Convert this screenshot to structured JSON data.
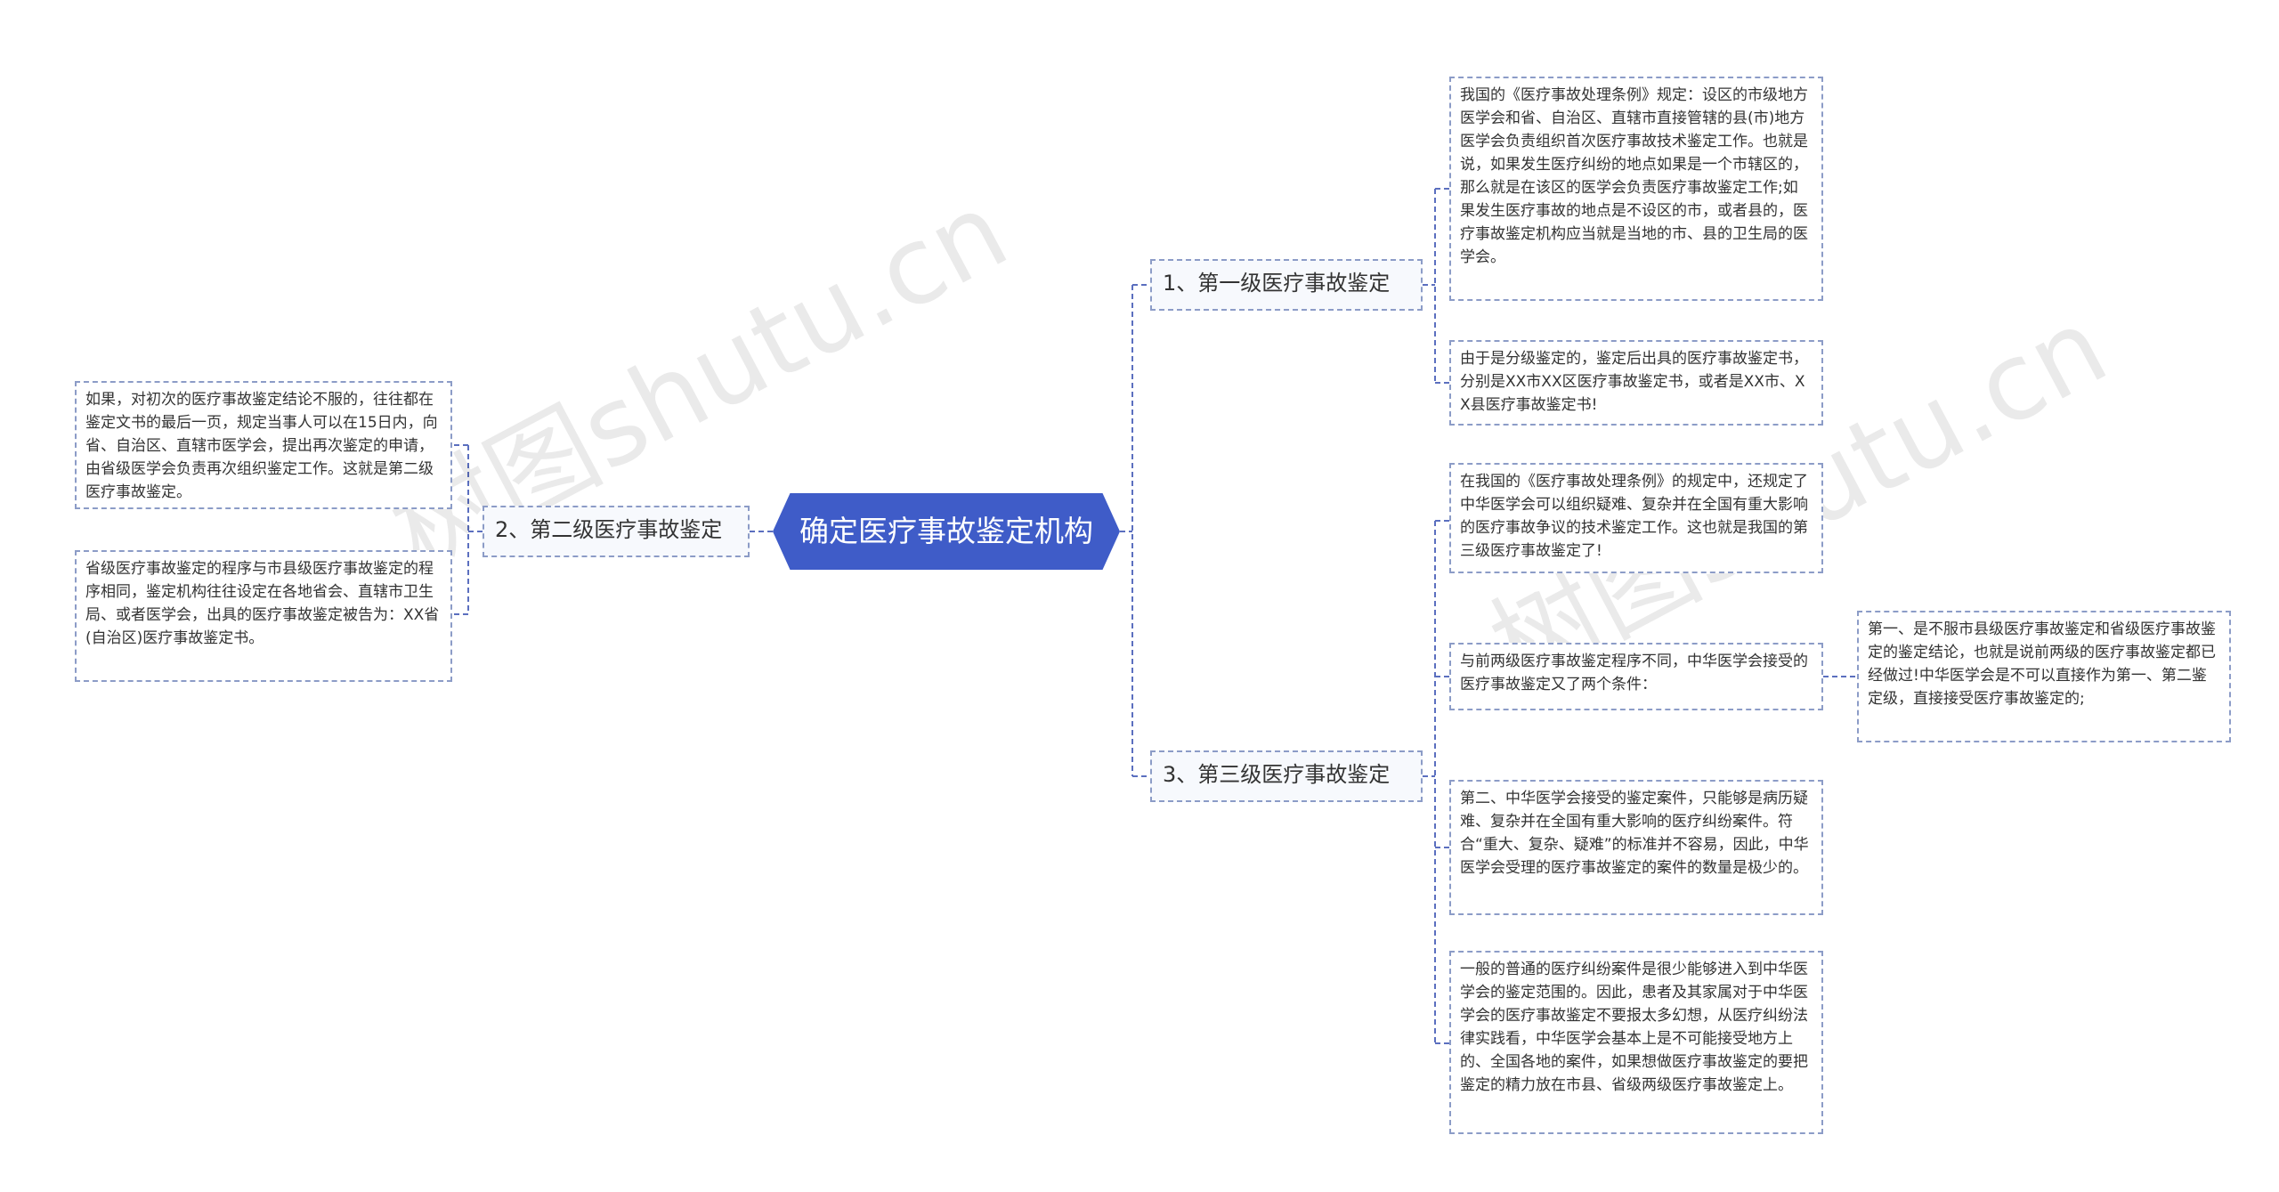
{
  "root": {
    "label": "确定医疗事故鉴定机构"
  },
  "branches": {
    "first": {
      "label": "1、第一级医疗事故鉴定",
      "details": [
        "我国的《医疗事故处理条例》规定：设区的市级地方医学会和省、自治区、直辖市直接管辖的县(市)地方医学会负责组织首次医疗事故技术鉴定工作。也就是说，如果发生医疗纠纷的地点如果是一个市辖区的，那么就是在该区的医学会负责医疗事故鉴定工作;如果发生医疗事故的地点是不设区的市，或者县的，医疗事故鉴定机构应当就是当地的市、县的卫生局的医学会。",
        "由于是分级鉴定的，鉴定后出具的医疗事故鉴定书，分别是XX市XX区医疗事故鉴定书，或者是XX市、XX县医疗事故鉴定书!"
      ]
    },
    "second": {
      "label": "2、第二级医疗事故鉴定",
      "details": [
        "如果，对初次的医疗事故鉴定结论不服的，往往都在鉴定文书的最后一页，规定当事人可以在15日内，向省、自治区、直辖市医学会，提出再次鉴定的申请，由省级医学会负责再次组织鉴定工作。这就是第二级医疗事故鉴定。",
        "省级医疗事故鉴定的程序与市县级医疗事故鉴定的程序相同，鉴定机构往往设定在各地省会、直辖市卫生局、或者医学会，出具的医疗事故鉴定被告为：XX省(自治区)医疗事故鉴定书。"
      ]
    },
    "third": {
      "label": "3、第三级医疗事故鉴定",
      "details": [
        "在我国的《医疗事故处理条例》的规定中，还规定了中华医学会可以组织疑难、复杂并在全国有重大影响的医疗事故争议的技术鉴定工作。这也就是我国的第三级医疗事故鉴定了!",
        "与前两级医疗事故鉴定程序不同，中华医学会接受的医疗事故鉴定又了两个条件：",
        "第二、中华医学会接受的鉴定案件，只能够是病历疑难、复杂并在全国有重大影响的医疗纠纷案件。符合“重大、复杂、疑难”的标准并不容易，因此，中华医学会受理的医疗事故鉴定的案件的数量是极少的。",
        "一般的普通的医疗纠纷案件是很少能够进入到中华医学会的鉴定范围的。因此，患者及其家属对于中华医学会的医疗事故鉴定不要报太多幻想，从医疗纠纷法律实践看，中华医学会基本上是不可能接受地方上的、全国各地的案件，如果想做医疗事故鉴定的要把鉴定的精力放在市县、省级两级医疗事故鉴定上。"
      ],
      "condition_detail": "第一、是不服市县级医疗事故鉴定和省级医疗事故鉴定的鉴定结论，也就是说前两级的医疗事故鉴定都已经做过!中华医学会是不可以直接作为第一、第二鉴定级，直接接受医疗事故鉴定的;"
    }
  },
  "watermarks": [
    "树图shutu.cn",
    "树图shutu.cn"
  ],
  "colors": {
    "root_fill": "#3f5cc8",
    "connector": "#5b6fbf",
    "node_border": "#8c9cc7",
    "text": "#333333"
  }
}
